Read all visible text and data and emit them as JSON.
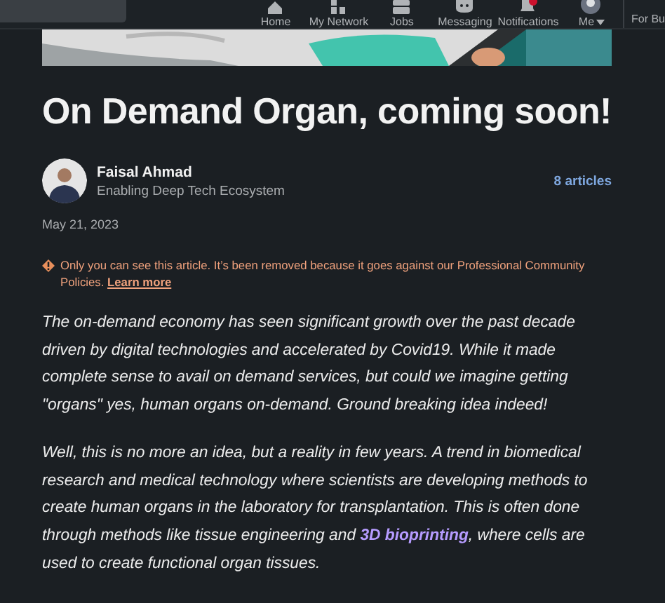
{
  "nav": {
    "items": [
      {
        "label": "Home",
        "kind": "home"
      },
      {
        "label": "My Network",
        "kind": "network"
      },
      {
        "label": "Jobs",
        "kind": "jobs"
      },
      {
        "label": "Messaging",
        "kind": "messaging"
      },
      {
        "label": "Notifications",
        "kind": "bell"
      },
      {
        "label": "Me",
        "kind": "me"
      }
    ],
    "business": "For Bu"
  },
  "article": {
    "title": "On Demand Organ, coming soon!",
    "author": {
      "name": "Faisal Ahmad",
      "headline": "Enabling Deep Tech Ecosystem",
      "articles": "8 articles"
    },
    "date": "May 21, 2023",
    "notice": {
      "text": "Only you can see this article. It’s been removed because it goes against our Professional Community Policies.",
      "link": "Learn more"
    },
    "paragraphs": [
      [
        {
          "kind": "text",
          "text": "The on-demand economy has seen significant growth over the past decade driven by digital technologies and accelerated by Covid19. While it made complete sense to avail on demand services, but could we imagine getting \"organs\" yes, human organs on-demand. Ground breaking idea indeed!"
        }
      ],
      [
        {
          "kind": "text",
          "text": "Well, this is no more an idea, but a reality in few years. A trend in biomedical research and medical technology where scientists are developing methods to create human organs in the laboratory for transplantation. This is often done through methods like tissue engineering and "
        },
        {
          "kind": "link",
          "text": "3D bioprinting"
        },
        {
          "kind": "text",
          "text": ", where cells are used to create functional organ tissues."
        }
      ]
    ]
  }
}
